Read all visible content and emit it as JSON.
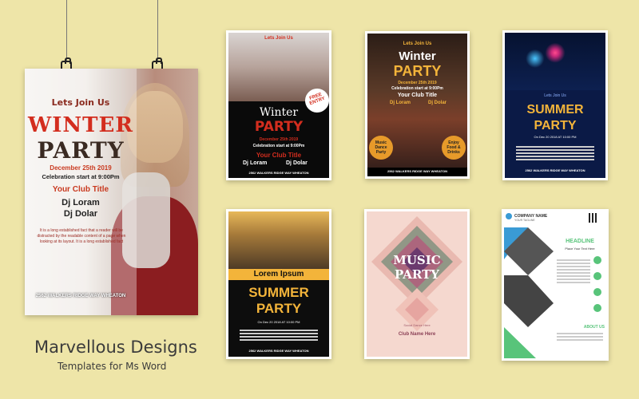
{
  "brand": {
    "title": "Marvellous Designs",
    "subtitle": "Templates for Ms Word"
  },
  "colors": {
    "background": "#eee5a8",
    "red": "#d32d1e",
    "navy": "#0b1a46",
    "gold": "#f3b43a",
    "green": "#58c47a"
  },
  "main_poster": {
    "lead": "Lets Join Us",
    "title1": "WINTER",
    "title2": "PARTY",
    "date": "December 25th 2019",
    "time": "Celebration start at 9:00Pm",
    "club": "Your Club Title",
    "dj1": "Dj Loram",
    "dj2": "Dj Dolar",
    "body": "It is a long established fact that a reader will be distracted by the readable content of a page when looking at its layout. It is a long established fact",
    "address": "2562 WALKERS RIDGE WAY WHEATON"
  },
  "t1": {
    "lead": "Lets Join Us",
    "title1": "Winter",
    "title2": "PARTY",
    "badge1": "FREE",
    "badge2": "ENTRY",
    "date": "December 25th 2019",
    "time": "Celebration start at 9:00Pm",
    "club": "Your Club Title",
    "dj1": "Dj Loram",
    "dj2": "Dj Dolar",
    "address": "2562 WALKERS RIDGE WAY WHEATON"
  },
  "t2": {
    "lead": "Lets Join Us",
    "title1": "Winter",
    "title2": "PARTY",
    "date": "December 25th 2019",
    "time": "Celebration start at 9:00Pm",
    "club": "Your Club Title",
    "dj1": "Dj Loram",
    "dj2": "Dj Dolar",
    "circle_left": "Music Dance Party",
    "circle_right": "Enjoy Food & Drinks",
    "address": "2562 WALKERS RIDGE WAY WHEATON"
  },
  "t3": {
    "lead": "Lets Join Us",
    "title1": "SUMMER",
    "title2": "PARTY",
    "date": "On Dec 20 2018 AT 10:00 PM",
    "address": "2562 WALKERS RIDGE WAY WHEATON"
  },
  "t4": {
    "banner": "Lorem Ipsum",
    "title1": "SUMMER",
    "title2": "PARTY",
    "date": "On Dec 20 2018 AT 10:00 PM",
    "address": "2562 WALKERS RIDGE WAY WHEATON"
  },
  "t5": {
    "title1": "MUSIC",
    "title2": "PARTY",
    "date": "Social Dance Here",
    "club": "Club Name Here"
  },
  "t6": {
    "company": "COMPANY NAME",
    "tagline": "YOUR TAGLINE",
    "headline": "HEADLINE",
    "subhead": "Place Your Text Here",
    "about": "ABOUT US"
  }
}
